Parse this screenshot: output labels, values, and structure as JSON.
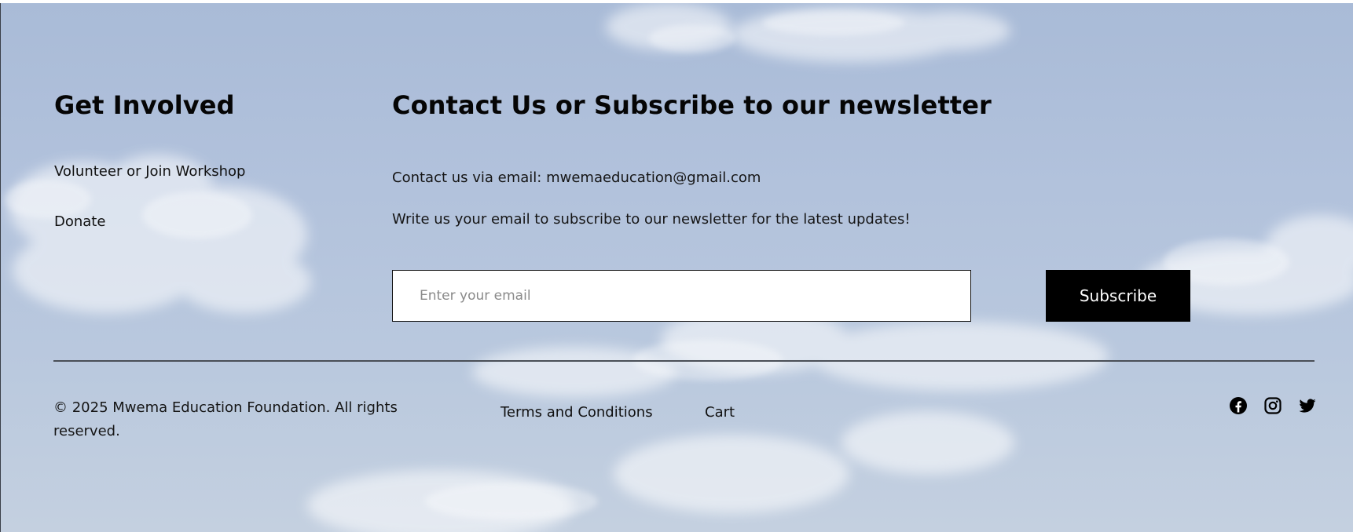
{
  "get_involved": {
    "title": "Get Involved",
    "links": [
      "Volunteer or Join Workshop",
      "Donate"
    ]
  },
  "contact": {
    "title": "Contact Us or Subscribe to our newsletter",
    "email_line": "Contact us via email: mwemaeducation@gmail.com",
    "subscribe_prompt": "Write us your email to subscribe to our newsletter for the latest updates!",
    "email_placeholder": "Enter your email",
    "email_value": "",
    "subscribe_label": "Subscribe"
  },
  "bottom": {
    "copyright": "© 2025 Mwema Education Foundation. All rights reserved.",
    "links": [
      "Terms and Conditions",
      "Cart"
    ],
    "social_icons": [
      "facebook-icon",
      "instagram-icon",
      "twitter-icon"
    ]
  },
  "colors": {
    "sky_background": "#b2c2dc",
    "text": "#000000",
    "button_background": "#000000",
    "button_text": "#ffffff",
    "divider": "#4a4f57"
  }
}
